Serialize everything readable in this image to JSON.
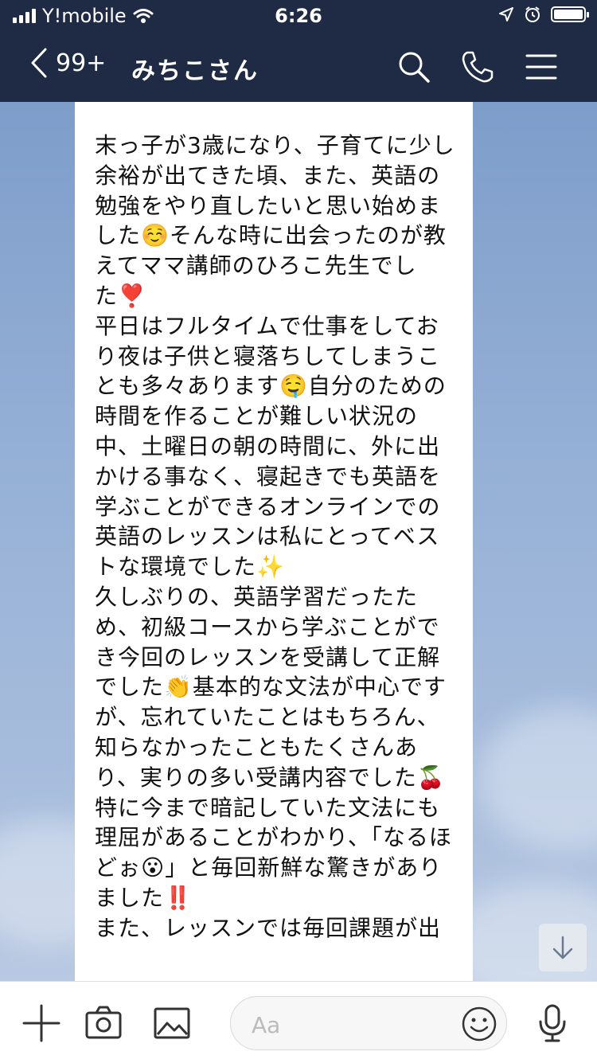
{
  "status": {
    "carrier": "Y!mobile",
    "time": "6:26"
  },
  "header": {
    "back_count": "99+",
    "title": "みちこさん"
  },
  "message": {
    "text": "末っ子が3歳になり、子育てに少し余裕が出てきた頃、また、英語の勉強をやり直したいと思い始めました☺️そんな時に出会ったのが教えてママ講師のひろこ先生でした❣️\n平日はフルタイムで仕事をしており夜は子供と寝落ちしてしまうことも多々あります🤤自分のための時間を作ることが難しい状況の中、土曜日の朝の時間に、外に出かける事なく、寝起きでも英語を学ぶことができるオンラインでの英語のレッスンは私にとってベストな環境でした✨\n久しぶりの、英語学習だったため、初級コースから学ぶことができ今回のレッスンを受講して正解でした👏基本的な文法が中心ですが、忘れていたことはもちろん、知らなかったこともたくさんあり、実りの多い受講内容でした🍒特に今まで暗記していた文法にも理屈があることがわかり、「なるほどぉ😮」と毎回新鮮な驚きがありました‼️\nまた、レッスンでは毎回課題が出"
  },
  "input": {
    "placeholder": "Aa"
  },
  "icons": {
    "back": "chevron-left-icon",
    "search": "search-icon",
    "phone": "phone-icon",
    "menu": "menu-icon",
    "plus": "plus-icon",
    "camera": "camera-icon",
    "image": "image-icon",
    "emoji": "emoji-icon",
    "mic": "microphone-icon",
    "scroll": "arrow-down-icon"
  },
  "colors": {
    "header_bg": "#1f2a44",
    "bubble_bg": "#ffffff",
    "chat_bg": "#8aa7cf"
  }
}
